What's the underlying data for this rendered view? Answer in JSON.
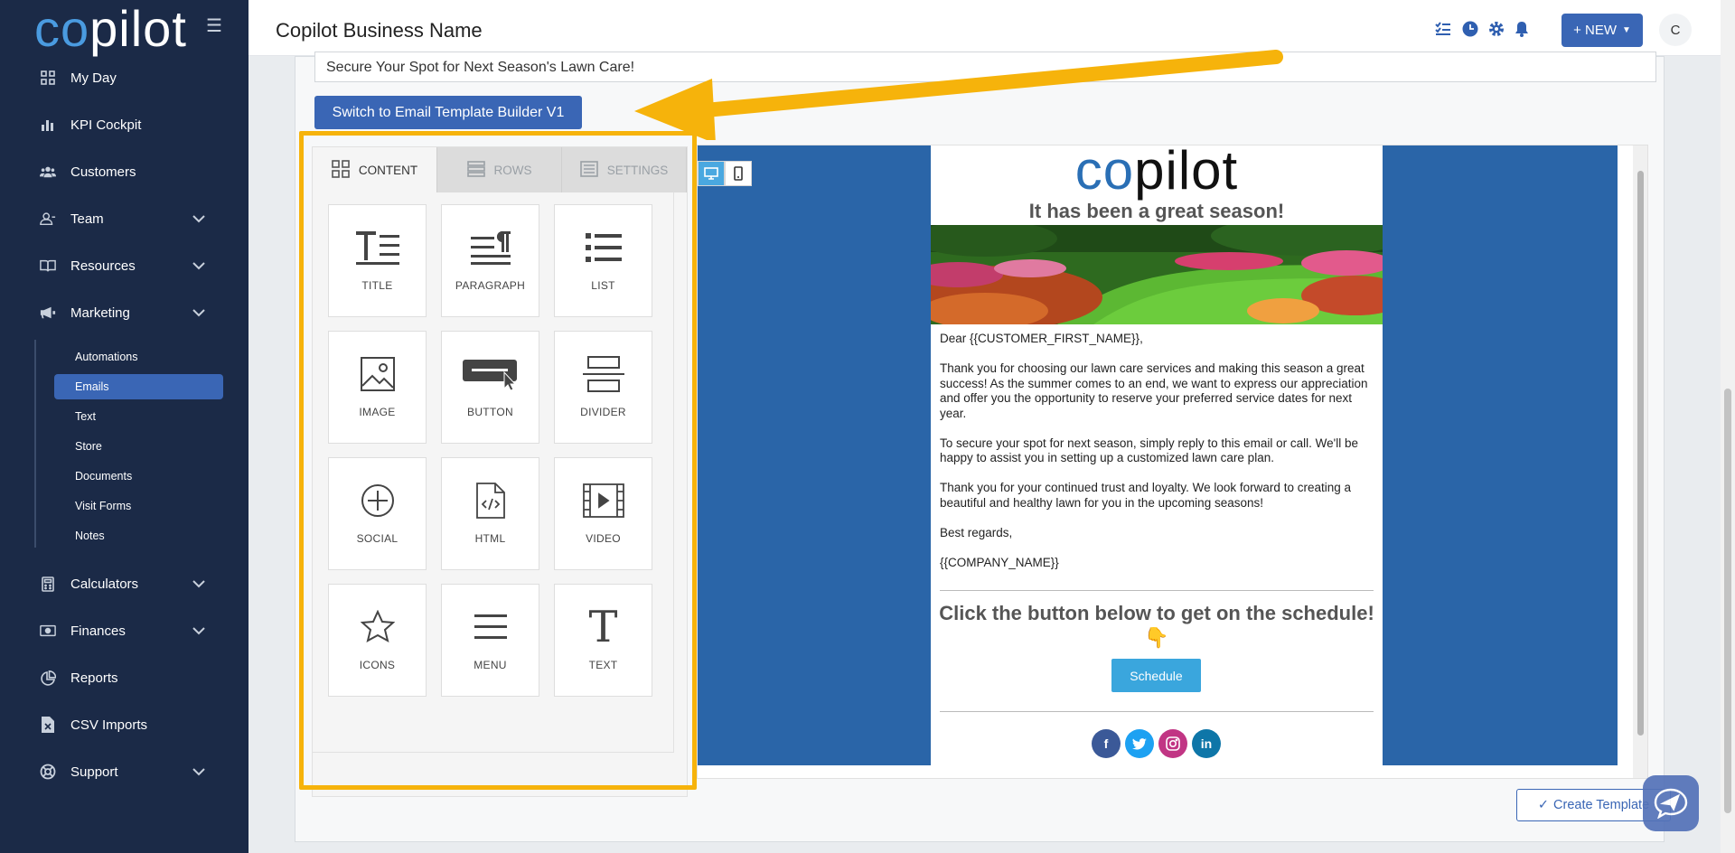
{
  "sidebar": {
    "logo": {
      "co": "co",
      "rest": "pilot"
    },
    "items": [
      {
        "label": "My Day",
        "icon": "grid-icon"
      },
      {
        "label": "KPI Cockpit",
        "icon": "bar-chart-icon"
      },
      {
        "label": "Customers",
        "icon": "users-icon"
      },
      {
        "label": "Team",
        "icon": "user-icon"
      },
      {
        "label": "Resources",
        "icon": "book-icon"
      },
      {
        "label": "Marketing",
        "icon": "megaphone-icon"
      },
      {
        "label": "Calculators",
        "icon": "calculator-icon"
      },
      {
        "label": "Finances",
        "icon": "money-icon"
      },
      {
        "label": "Reports",
        "icon": "pie-chart-icon"
      },
      {
        "label": "CSV Imports",
        "icon": "file-csv-icon"
      },
      {
        "label": "Support",
        "icon": "lifebuoy-icon"
      }
    ],
    "marketing_sub": [
      "Automations",
      "Emails",
      "Text",
      "Store",
      "Documents",
      "Visit Forms",
      "Notes"
    ]
  },
  "header": {
    "business_name": "Copilot Business Name",
    "new_label": "+ NEW",
    "avatar_initial": "C"
  },
  "editor": {
    "subject": "Secure Your Spot for Next Season's Lawn Care!",
    "switch_label": "Switch to Email Template Builder V1",
    "tabs": [
      "CONTENT",
      "ROWS",
      "SETTINGS"
    ],
    "blocks": [
      "TITLE",
      "PARAGRAPH",
      "LIST",
      "IMAGE",
      "BUTTON",
      "DIVIDER",
      "SOCIAL",
      "HTML",
      "VIDEO",
      "ICONS",
      "MENU",
      "TEXT"
    ],
    "create_label": "Create Template"
  },
  "email": {
    "logo": {
      "co": "co",
      "rest": "pilot"
    },
    "heading": "It has been a great season!",
    "greeting": "Dear {{CUSTOMER_FIRST_NAME}},",
    "p1": "Thank you for choosing our lawn care services and making this season a great success! As the summer comes to an end, we want to express our appreciation and offer you the opportunity to reserve your preferred service dates for next year.",
    "p2": "To secure your spot for next season, simply reply to this email or call. We'll be happy to assist you in setting up a customized lawn care plan.",
    "p3": "Thank you for your continued trust and loyalty. We look forward to creating a beautiful and healthy lawn for you in the upcoming seasons!",
    "closing": "Best regards,",
    "company": "{{COMPANY_NAME}}",
    "cta_heading": "Click the button below to get on the schedule! 👇",
    "button": "Schedule",
    "socials": [
      "facebook-icon",
      "twitter-icon",
      "instagram-icon",
      "linkedin-icon"
    ]
  },
  "colors": {
    "sidebar": "#1b2a47",
    "accent": "#3a66b5",
    "highlight": "#f6b30b",
    "preview_bg": "#2a65a8"
  }
}
